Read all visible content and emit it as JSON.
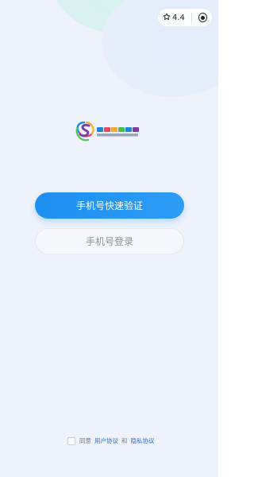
{
  "capsule": {
    "rating": "4.4",
    "icons": [
      "star-icon",
      "record-icon"
    ]
  },
  "logo": {
    "icon": "app-logo-icon"
  },
  "login": {
    "quick_verify_label": "手机号快速验证",
    "phone_login_label": "手机号登录"
  },
  "agreement": {
    "prefix": "同意",
    "user_agreement": "用户协议",
    "and": "和",
    "privacy_agreement": "隐私协议"
  },
  "colors": {
    "primary": "#1d8ff2",
    "link": "#2a6fd6",
    "background": "#eef3fb"
  }
}
